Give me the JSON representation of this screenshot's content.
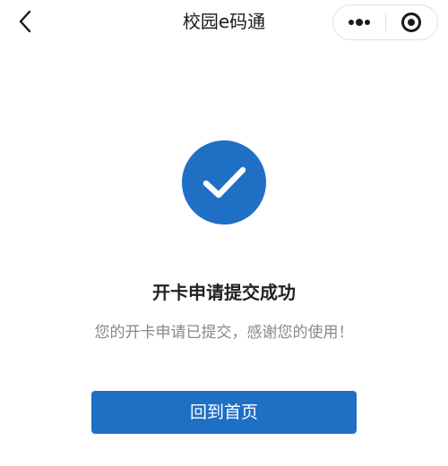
{
  "nav": {
    "title": "校园e码通",
    "back_icon": "chevron-left-icon",
    "more_icon": "more-dots-icon",
    "close_icon": "target-circle-icon"
  },
  "result": {
    "icon": "check-circle-icon",
    "title": "开卡申请提交成功",
    "description": "您的开卡申请已提交，感谢您的使用！"
  },
  "actions": {
    "home_label": "回到首页"
  },
  "colors": {
    "accent": "#1f6fc5",
    "text_primary": "#222222",
    "text_secondary": "#888888",
    "background": "#ffffff"
  }
}
